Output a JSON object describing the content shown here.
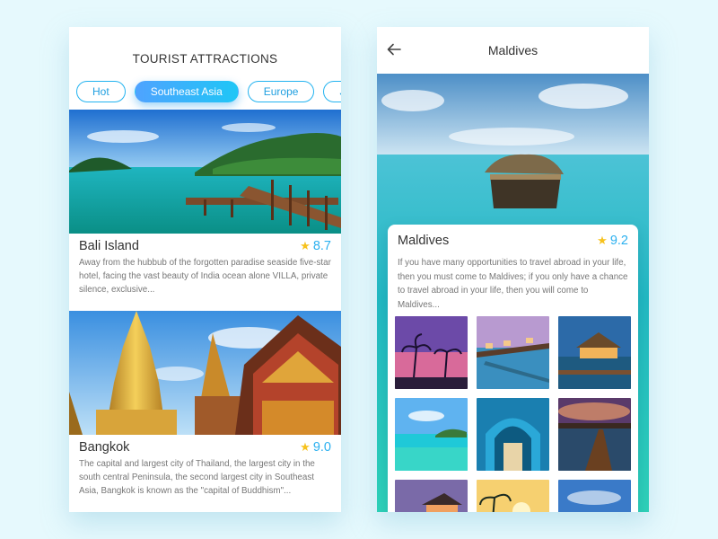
{
  "left_screen": {
    "title": "TOURIST ATTRACTIONS",
    "tabs": [
      {
        "label": "Hot",
        "active": false
      },
      {
        "label": "Southeast Asia",
        "active": true
      },
      {
        "label": "Europe",
        "active": false
      },
      {
        "label": "Japan",
        "active": false
      }
    ],
    "cards": [
      {
        "title": "Bali Island",
        "rating": "8.7",
        "description": "Away from the hubbub of the forgotten paradise seaside five-star hotel, facing the vast beauty of India ocean alone VILLA, private silence, exclusive..."
      },
      {
        "title": "Bangkok",
        "rating": "9.0",
        "description": "The capital and largest city of Thailand, the largest city in the south central Peninsula, the second largest city in Southeast Asia, Bangkok is known as the \"capital of Buddhism\"..."
      }
    ]
  },
  "right_screen": {
    "title": "Maldives",
    "card": {
      "title": "Maldives",
      "rating": "9.2",
      "description": "If you have many opportunities to travel abroad in your life, then you must come to Maldives; if you only have a chance to travel abroad in your life, then you will come to Maldives..."
    },
    "gallery_count": 9
  },
  "colors": {
    "background": "#e6f9fd",
    "accent": "#23b3f0",
    "rating_text": "#2bb0ef",
    "star": "#f7c21d"
  },
  "icons": [
    "back-arrow-icon",
    "star-icon"
  ]
}
